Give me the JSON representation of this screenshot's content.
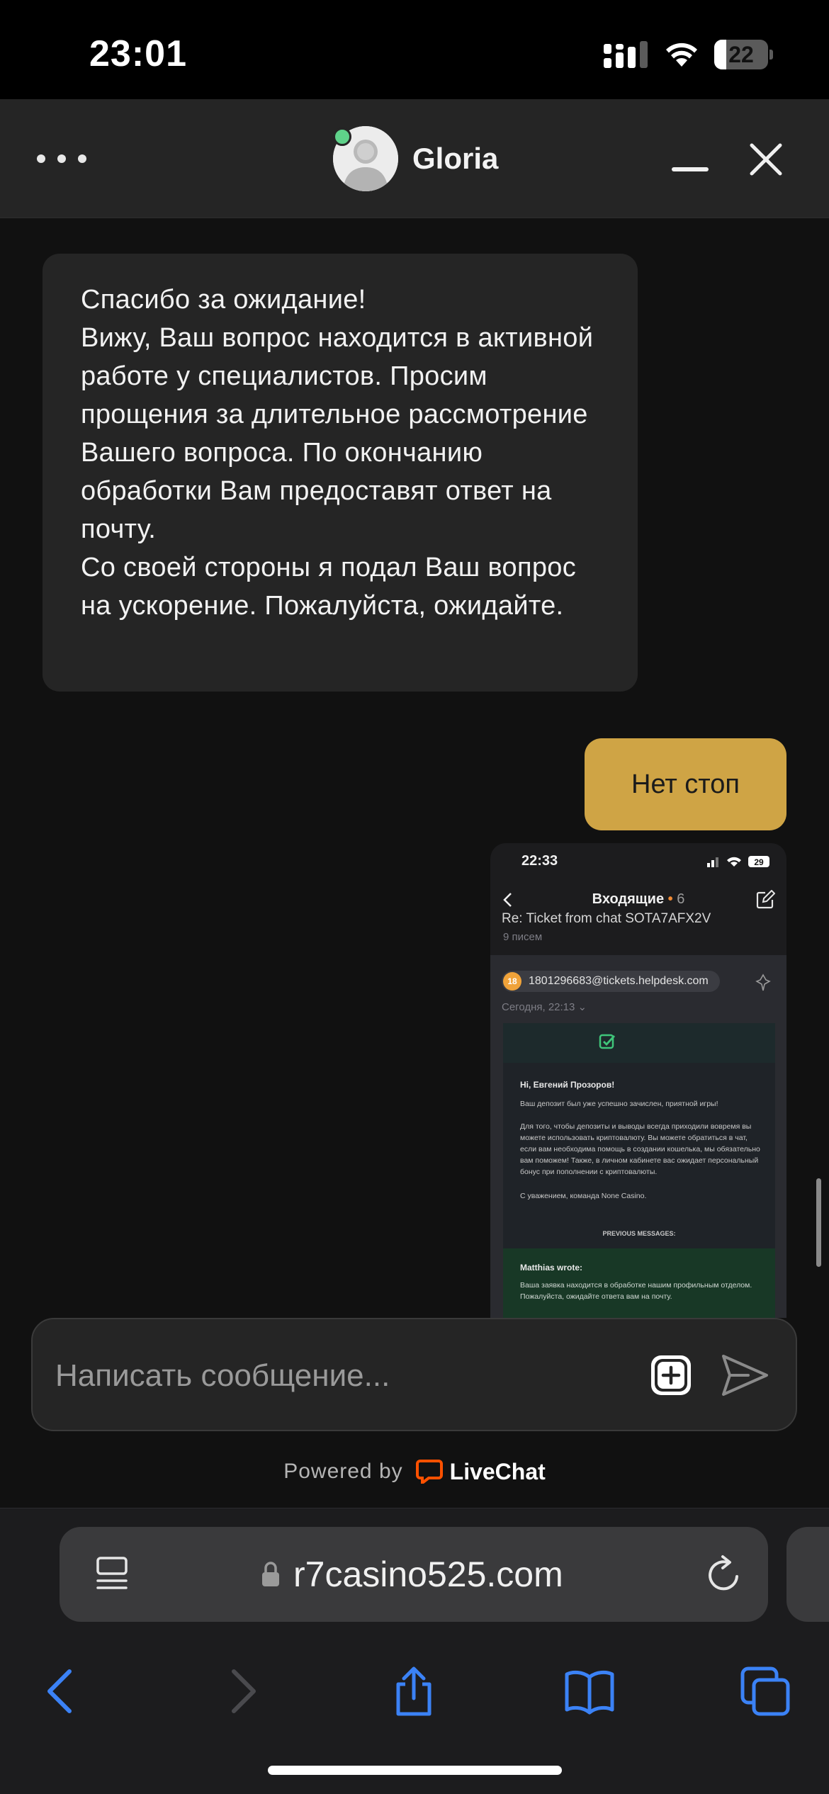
{
  "status_bar": {
    "time": "23:01",
    "battery": "22",
    "battery_level_percent": 22
  },
  "header": {
    "agent_name": "Gloria",
    "agent_online": true
  },
  "messages": {
    "agent_message": "Спасибо за ожидание!\nВижу, Ваш вопрос находится в активной работе у специалистов. Просим прощения за длительное рассмотрение Вашего вопроса. По окончанию обработки Вам предоставят ответ на почту.\nСо своей стороны я подал Ваш вопрос на ускорение. Пожалуйста, ожидайте.",
    "user_message": "Нет стоп",
    "attachment": {
      "time": "22:33",
      "battery": "29",
      "mailbox_title": "Входящие",
      "mailbox_dot": "•",
      "unread_count": "6",
      "subject": "Re: Ticket from chat SOTA7AFX2V",
      "mail_count": "9 писем",
      "sender_badge": "18",
      "sender_email": "1801296683@tickets.helpdesk.com",
      "date": "Сегодня, 22:13 ⌄",
      "greeting": "Hi, Евгений Прозоров!",
      "line1": "Ваш депозит был уже успешно зачислен, приятной игры!",
      "line2": "Для того, чтобы депозиты и выводы всегда приходили вовремя вы можете использовать криптовалюту. Вы можете обратиться в чат, если вам необходима помощь в создании кошелька, мы обязательно вам поможем! Также, в личном кабинете вас ожидает персональный бонус при пополнении с криптовалюты.",
      "line3": "С уважением, команда None Casino.",
      "previous_label": "PREVIOUS MESSAGES:",
      "quote_author": "Matthias wrote:",
      "quote_text": "Ваша заявка находится в обработке нашим профильным отделом. Пожалуйста, ожидайте ответа вам на почту."
    }
  },
  "composer": {
    "placeholder": "Написать сообщение..."
  },
  "footer": {
    "powered_by": "Powered by",
    "brand": "LiveChat"
  },
  "browser": {
    "url": "r7casino525.com"
  },
  "colors": {
    "accent_user_bubble": "#cfa445",
    "agent_bubble": "#252525",
    "background": "#111111",
    "online": "#5fd28a",
    "livechat_orange": "#ff5100",
    "ios_blue": "#3b82f6"
  },
  "icons": {
    "more": "more-icon",
    "minimize": "minimize-icon",
    "close": "close-icon",
    "attach": "plus-square-icon",
    "send": "send-icon",
    "reader": "reader-icon",
    "lock": "lock-icon",
    "reload": "reload-icon",
    "back": "chevron-left-icon",
    "forward": "chevron-right-icon",
    "share": "share-icon",
    "bookmarks": "book-icon",
    "tabs": "tabs-icon"
  }
}
